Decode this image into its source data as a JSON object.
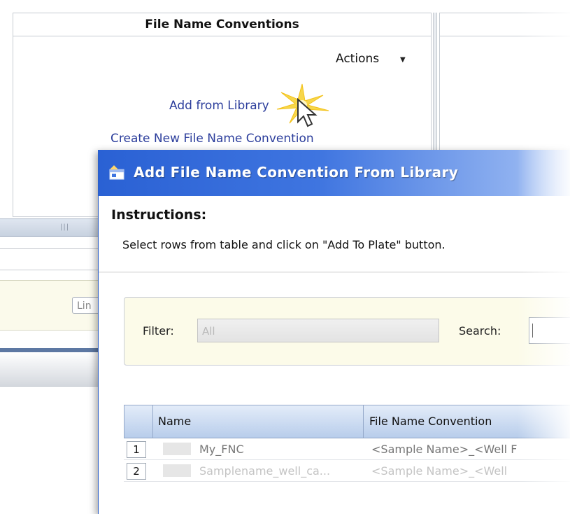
{
  "panel": {
    "title": "File Name Conventions",
    "actions_label": "Actions",
    "add_from_library": "Add from Library",
    "create_new": "Create New File Name Convention"
  },
  "left_strip": {
    "partial_button": "Lin"
  },
  "dialog": {
    "title": "Add File Name Convention From Library",
    "instructions_title": "Instructions:",
    "instructions_text": "Select rows from table and click on \"Add To Plate\" button.",
    "filter_label": "Filter:",
    "filter_value": "All",
    "search_label": "Search:",
    "columns": [
      "Name",
      "File Name Convention"
    ],
    "rows": [
      {
        "num": "1",
        "name": "My_FNC",
        "convention": "<Sample Name>_<Well F"
      },
      {
        "num": "2",
        "name": "Samplename_well_ca...",
        "convention": "<Sample Name>_<Well"
      }
    ]
  },
  "colors": {
    "title_bar": "#2a61d4",
    "link": "#2c3e9c",
    "filter_bg": "#fcfbe9"
  },
  "icons": [
    "app-window-icon",
    "dropdown-caret-icon",
    "mouse-cursor-icon",
    "click-sparkle-icon"
  ]
}
